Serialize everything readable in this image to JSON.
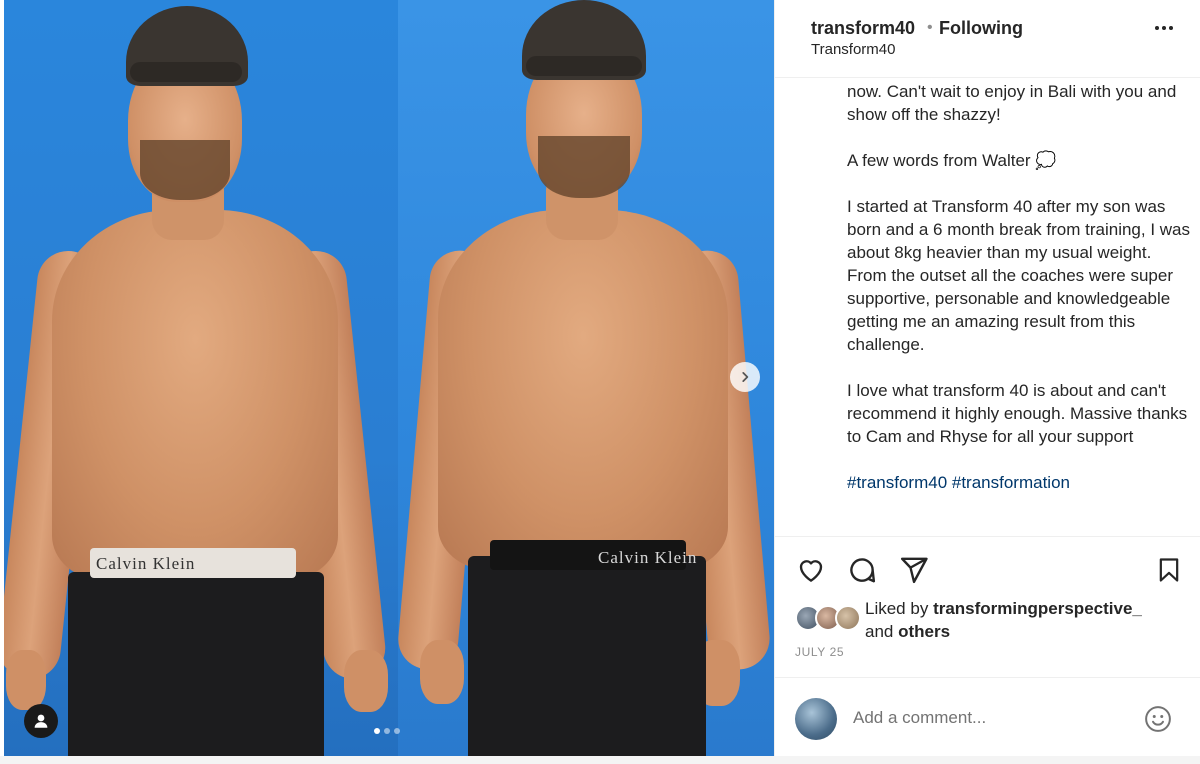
{
  "post": {
    "username": "transform40",
    "separator": "•",
    "follow_status": "Following",
    "subtitle": "Transform40"
  },
  "media": {
    "left_band_text": "Calvin Klein",
    "right_band_text": "Calvin Klein",
    "carousel_dots": 3,
    "active_dot": 0
  },
  "caption": {
    "lines": [
      "now. Can't wait to enjoy in Bali with you and show off the shazzy!",
      "",
      "A few words from Walter 💭",
      "",
      "I started at Transform 40 after my son was born and a 6 month break from training, I was about 8kg heavier than my usual weight. From the outset all the coaches were super supportive, personable and knowledgeable getting me an amazing result from this challenge.",
      "",
      "I love what transform 40 is about and can't recommend it highly enough. Massive thanks to Cam and Rhyse for all your support",
      ""
    ],
    "hashtags": "#transform40 #transformation"
  },
  "likes": {
    "prefix": "Liked by",
    "user": "transformingperspective_",
    "and": "and",
    "others": "others"
  },
  "date": "JULY 25",
  "comment": {
    "placeholder": "Add a comment..."
  },
  "icons": {
    "like": "heart-icon",
    "comment": "comment-bubble-icon",
    "share": "paper-plane-icon",
    "save": "bookmark-icon",
    "emoji": "smiley-icon",
    "next": "chevron-right-icon",
    "tagged": "person-icon",
    "more": "ellipsis-icon"
  },
  "colors": {
    "wall_blue": "#2b7fd6",
    "text": "#262626",
    "muted": "#8e8e8e",
    "hashtag": "#00376b"
  }
}
